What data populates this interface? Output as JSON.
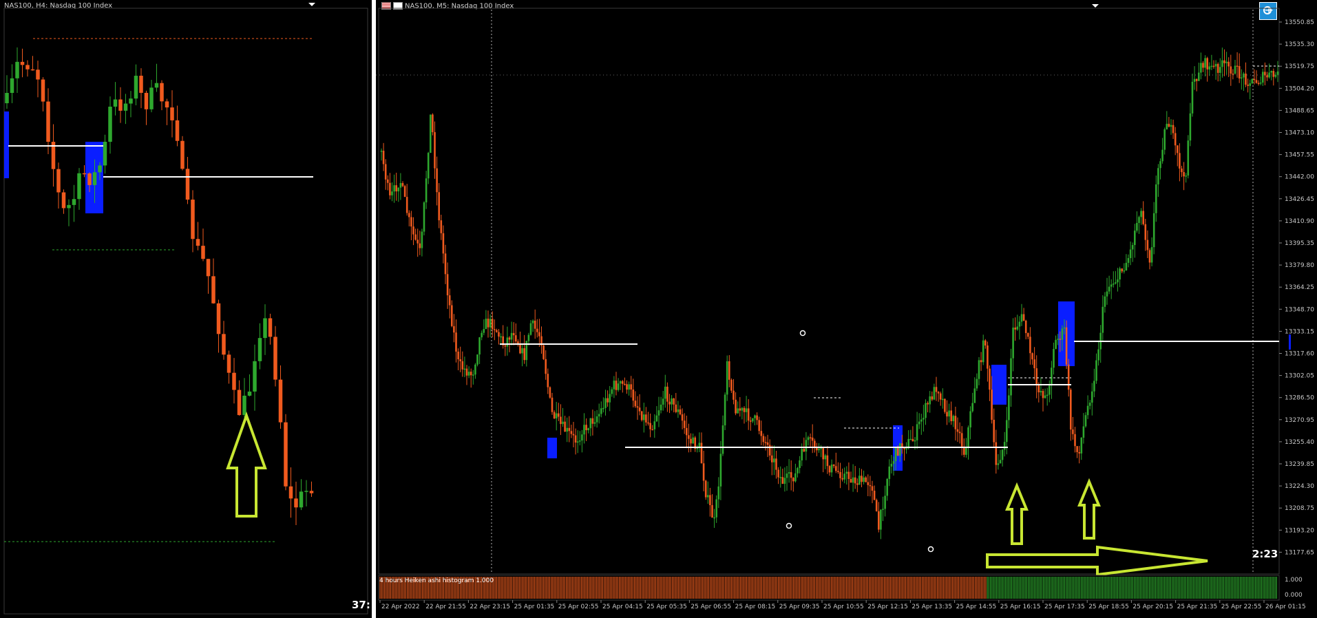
{
  "left_chart": {
    "title": "NAS100, H4:  Nasdaq 100 Index",
    "timer": "37:",
    "colors": {
      "bull": "#2ea82e",
      "bear": "#f05a1e",
      "box": "#0a1eff",
      "level": "#ffffff",
      "arrow": "#c8e632"
    }
  },
  "right_chart": {
    "title": "NAS100, M5:  Nasdaq 100 Index",
    "timer": "2:23",
    "histogram_label": "4 hours Heiken ashi histogram 1.000",
    "price_labels": [
      "13550.85",
      "13535.30",
      "13519.75",
      "13504.20",
      "13488.65",
      "13473.10",
      "13457.55",
      "13442.00",
      "13426.45",
      "13410.90",
      "13395.35",
      "13379.80",
      "13364.25",
      "13348.70",
      "13333.15",
      "13317.60",
      "13302.05",
      "13286.50",
      "13270.95",
      "13255.40",
      "13239.85",
      "13224.30",
      "13208.75",
      "13193.20",
      "13177.65"
    ],
    "histogram_scale": [
      "1.000",
      "0.000"
    ],
    "time_labels": [
      "22 Apr 2022",
      "22 Apr 21:55",
      "22 Apr 23:15",
      "25 Apr 01:35",
      "25 Apr 02:55",
      "25 Apr 04:15",
      "25 Apr 05:35",
      "25 Apr 06:55",
      "25 Apr 08:15",
      "25 Apr 09:35",
      "25 Apr 10:55",
      "25 Apr 12:15",
      "25 Apr 13:35",
      "25 Apr 14:55",
      "25 Apr 16:15",
      "25 Apr 17:35",
      "25 Apr 18:55",
      "25 Apr 20:15",
      "25 Apr 21:35",
      "25 Apr 22:55",
      "26 Apr 01:15"
    ],
    "icons": {
      "crosshair": "crosshair-icon"
    }
  }
}
